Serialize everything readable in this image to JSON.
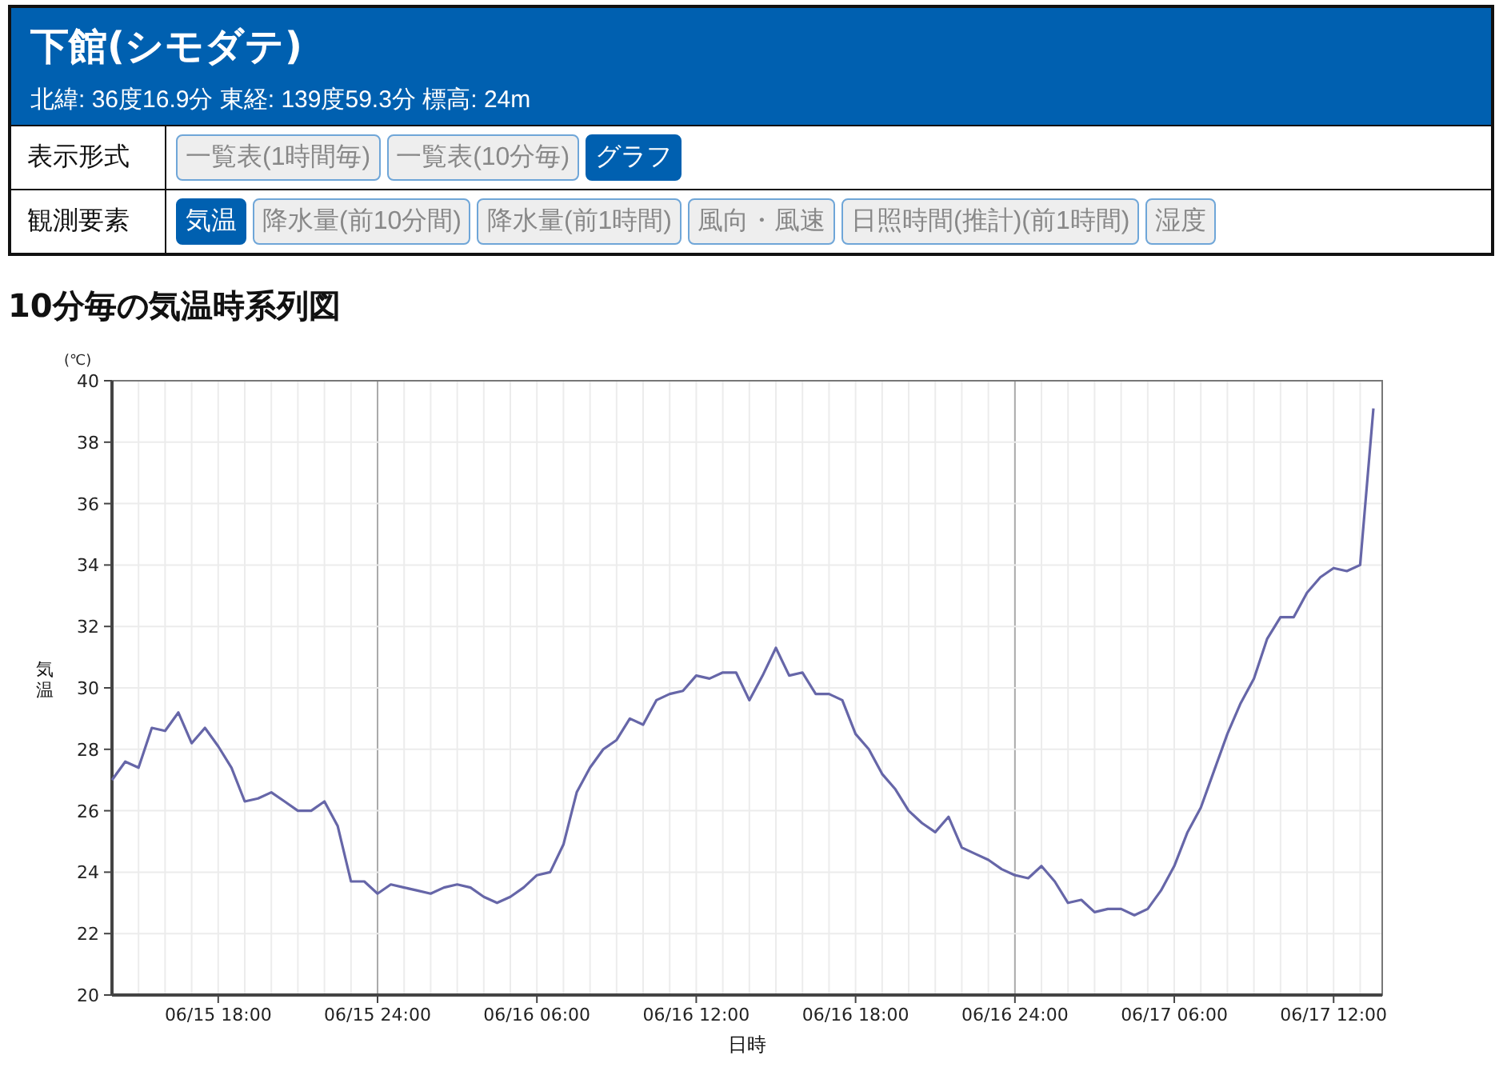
{
  "station": {
    "name": "下館(シモダテ)",
    "location": "北緯: 36度16.9分 東経: 139度59.3分 標高: 24m"
  },
  "rows": [
    {
      "label": "表示形式",
      "options": [
        {
          "label": "一覧表(1時間毎)",
          "selected": false
        },
        {
          "label": "一覧表(10分毎)",
          "selected": false
        },
        {
          "label": "グラフ",
          "selected": true
        }
      ]
    },
    {
      "label": "観測要素",
      "options": [
        {
          "label": "気温",
          "selected": true
        },
        {
          "label": "降水量(前10分間)",
          "selected": false
        },
        {
          "label": "降水量(前1時間)",
          "selected": false
        },
        {
          "label": "風向・風速",
          "selected": false
        },
        {
          "label": "日照時間(推計)(前1時間)",
          "selected": false
        },
        {
          "label": "湿度",
          "selected": false
        }
      ]
    }
  ],
  "chart_heading": "10分毎の気温時系列図",
  "chart": {
    "unit": "(℃)",
    "chart_data": {
      "type": "line",
      "xlabel": "日時",
      "ylabel": "気温",
      "categories": [
        null,
        null,
        null,
        null,
        null,
        null,
        null,
        null,
        "06/15 18:00",
        null,
        null,
        null,
        null,
        null,
        null,
        null,
        null,
        null,
        null,
        null,
        "06/15 24:00",
        null,
        null,
        null,
        null,
        null,
        null,
        null,
        null,
        null,
        null,
        null,
        "06/16 06:00",
        null,
        null,
        null,
        null,
        null,
        null,
        null,
        null,
        null,
        null,
        null,
        "06/16 12:00",
        null,
        null,
        null,
        null,
        null,
        null,
        null,
        null,
        null,
        null,
        null,
        "06/16 18:00",
        null,
        null,
        null,
        null,
        null,
        null,
        null,
        null,
        null,
        null,
        null,
        "06/16 24:00",
        null,
        null,
        null,
        null,
        null,
        null,
        null,
        null,
        null,
        null,
        null,
        "06/17 06:00",
        null,
        null,
        null,
        null,
        null,
        null,
        null,
        null,
        null,
        null,
        null,
        "06/17 12:00",
        null,
        null,
        null
      ],
      "series": [
        {
          "color": "#6666a8",
          "values": [
            27.0,
            27.6,
            27.4,
            28.7,
            28.6,
            29.2,
            28.2,
            28.7,
            28.1,
            27.4,
            26.3,
            26.4,
            26.6,
            26.3,
            26.0,
            26.0,
            26.3,
            25.5,
            23.7,
            23.7,
            23.3,
            23.6,
            23.5,
            23.4,
            23.3,
            23.5,
            23.6,
            23.5,
            23.2,
            23.0,
            23.2,
            23.5,
            23.9,
            24.0,
            24.9,
            26.6,
            27.4,
            28.0,
            28.3,
            29.0,
            28.8,
            29.6,
            29.8,
            29.9,
            30.4,
            30.3,
            30.5,
            30.5,
            29.6,
            30.4,
            31.3,
            30.4,
            30.5,
            29.8,
            29.8,
            29.6,
            28.5,
            28.0,
            27.2,
            26.7,
            26.0,
            25.6,
            25.3,
            25.8,
            24.8,
            24.6,
            24.4,
            24.1,
            23.9,
            23.8,
            24.2,
            23.7,
            23.0,
            23.1,
            22.7,
            22.8,
            22.8,
            22.6,
            22.8,
            23.4,
            24.2,
            25.3,
            26.1,
            27.3,
            28.5,
            29.5,
            30.3,
            31.6,
            32.3,
            32.3,
            33.1,
            33.6,
            33.9,
            33.8,
            34.0,
            39.1
          ]
        }
      ],
      "grid": true,
      "ylim": [
        20,
        40
      ],
      "yticks": [
        20,
        22,
        24,
        26,
        28,
        30,
        32,
        34,
        36,
        38,
        40
      ]
    }
  }
}
